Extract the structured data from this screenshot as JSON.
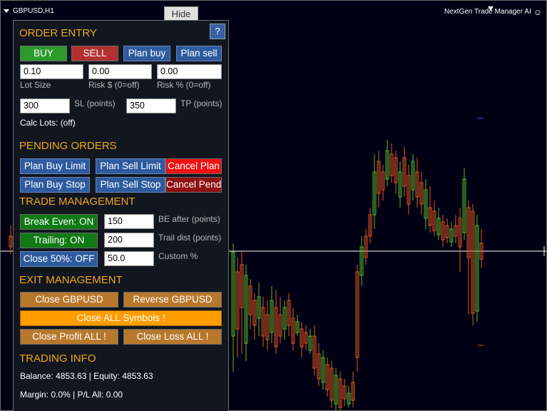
{
  "window": {
    "title": "GBPUSD,H1",
    "ea_name": "NextGen Trade Manager AI",
    "hide_label": "Hide"
  },
  "help_label": "?",
  "order_entry": {
    "title": "ORDER ENTRY",
    "buy": "BUY",
    "sell": "SELL",
    "plan_buy": "Plan buy",
    "plan_sell": "Plan sell",
    "lot_size_value": "0.10",
    "lot_size_label": "Lot Size",
    "risk_money_value": "0.00",
    "risk_money_label": "Risk $ (0=off)",
    "risk_pct_value": "0.00",
    "risk_pct_label": "Risk % (0=off)",
    "sl_value": "300",
    "sl_label": "SL (points)",
    "tp_value": "350",
    "tp_label": "TP (points)",
    "calc_lots": "Calc Lots: (off)"
  },
  "pending_orders": {
    "title": "PENDING ORDERS",
    "plan_buy_limit": "Plan Buy Limit",
    "plan_sell_limit": "Plan Sell Limit",
    "cancel_plan": "Cancel Plan",
    "plan_buy_stop": "Plan Buy Stop",
    "plan_sell_stop": "Plan Sell Stop",
    "cancel_pend": "Cancel Pend"
  },
  "trade_management": {
    "title": "TRADE MANAGEMENT",
    "break_even": "Break Even: ON",
    "be_value": "150",
    "be_label": "BE after (points)",
    "trailing": "Trailing: ON",
    "trail_value": "200",
    "trail_label": "Trail dist (points)",
    "close_half": "Close 50%: OFF",
    "custom_value": "50.0",
    "custom_label": "Custom %"
  },
  "exit_management": {
    "title": "EXIT MANAGEMENT",
    "close_symbol": "Close GBPUSD",
    "reverse_symbol": "Reverse GBPUSD",
    "close_all": "Close ALL Symbols !",
    "close_profit_all": "Close Profit ALL !",
    "close_loss_all": "Close Loss ALL !"
  },
  "trading_info": {
    "title": "TRADING INFO",
    "balance_line": "Balance: 4853.63 | Equity: 4853.63",
    "margin_line": "Margin: 0.0% | P/L All: 0.00"
  },
  "chart_colors": {
    "background": "#000015",
    "bull": "#4fbf26",
    "bear": "#e2571e",
    "crosshair": "#ffffff"
  }
}
